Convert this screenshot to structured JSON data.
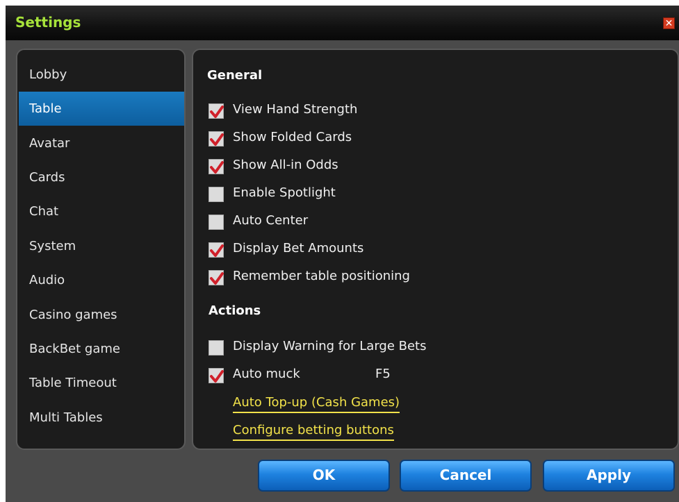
{
  "window": {
    "title": "Settings",
    "close_glyph": "✕"
  },
  "sidebar": {
    "items": [
      {
        "label": "Lobby",
        "selected": false
      },
      {
        "label": "Table",
        "selected": true
      },
      {
        "label": "Avatar",
        "selected": false
      },
      {
        "label": "Cards",
        "selected": false
      },
      {
        "label": "Chat",
        "selected": false
      },
      {
        "label": "System",
        "selected": false
      },
      {
        "label": "Audio",
        "selected": false
      },
      {
        "label": "Casino games",
        "selected": false
      },
      {
        "label": "BackBet game",
        "selected": false
      },
      {
        "label": "Table Timeout",
        "selected": false
      },
      {
        "label": "Multi Tables",
        "selected": false
      }
    ]
  },
  "general": {
    "heading": "General",
    "options": [
      {
        "label": "View Hand Strength",
        "checked": true
      },
      {
        "label": "Show Folded Cards",
        "checked": true
      },
      {
        "label": "Show All-in Odds",
        "checked": true
      },
      {
        "label": "Enable Spotlight",
        "checked": false
      },
      {
        "label": "Auto Center",
        "checked": false
      },
      {
        "label": "Display Bet Amounts",
        "checked": true
      },
      {
        "label": "Remember table positioning",
        "checked": true
      }
    ]
  },
  "actions": {
    "heading": "Actions",
    "options": [
      {
        "label": "Display Warning for Large Bets",
        "checked": false
      },
      {
        "label": "Auto muck",
        "checked": true,
        "hotkey": "F5"
      }
    ],
    "links": [
      "Auto Top-up (Cash Games)",
      "Configure betting buttons"
    ]
  },
  "buttons": {
    "ok": "OK",
    "cancel": "Cancel",
    "apply": "Apply"
  },
  "colors": {
    "accent": "#a6e23a",
    "link": "#f2e24a",
    "selected": "#1a7ac0",
    "check": "#d0202a"
  },
  "icons": {
    "close": "close-icon",
    "check": "checkmark-icon"
  }
}
